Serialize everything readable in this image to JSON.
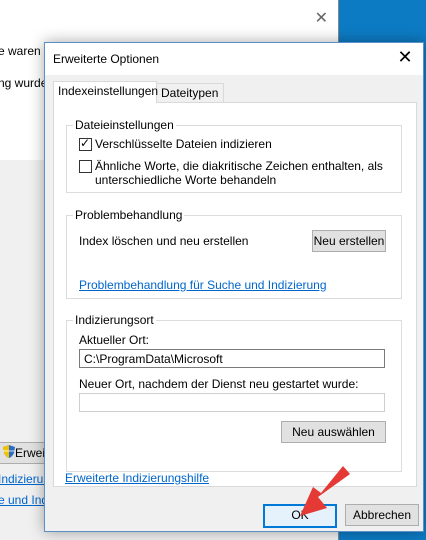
{
  "background_window": {
    "text_line1": "e waren wurden",
    "text_line2": "ng wurde",
    "advanced_button": "Erweit",
    "link1": "Indizierung",
    "link2": "e und Indi"
  },
  "dialog": {
    "title": "Erweiterte Optionen",
    "tabs": [
      {
        "label": "Indexeinstellungen",
        "active": true
      },
      {
        "label": "Dateitypen",
        "active": false
      }
    ],
    "file_settings": {
      "legend": "Dateieinstellungen",
      "encrypted_label": "Verschlüsselte Dateien indizieren",
      "encrypted_checked": true,
      "diacritics_label_1": "Ähnliche Worte, die diakritische Zeichen enthalten, als",
      "diacritics_label_2": "unterschiedliche Worte behandeln",
      "diacritics_checked": false
    },
    "troubleshooting": {
      "legend": "Problembehandlung",
      "rebuild_text": "Index löschen und neu erstellen",
      "rebuild_button": "Neu erstellen",
      "link": "Problembehandlung für Suche und Indizierung"
    },
    "index_location": {
      "legend": "Indizierungsort",
      "current_label": "Aktueller Ort:",
      "current_value": "C:\\ProgramData\\Microsoft",
      "new_label": "Neuer Ort, nachdem der Dienst neu gestartet wurde:",
      "new_value": "",
      "select_button": "Neu auswählen"
    },
    "help_link": "Erweiterte Indizierungshilfe",
    "ok_button": "OK",
    "cancel_button": "Abbrechen"
  },
  "colors": {
    "accent": "#0078d7",
    "link": "#0066cc",
    "arrow": "#e53935",
    "desktop": "#0d7bc4"
  }
}
